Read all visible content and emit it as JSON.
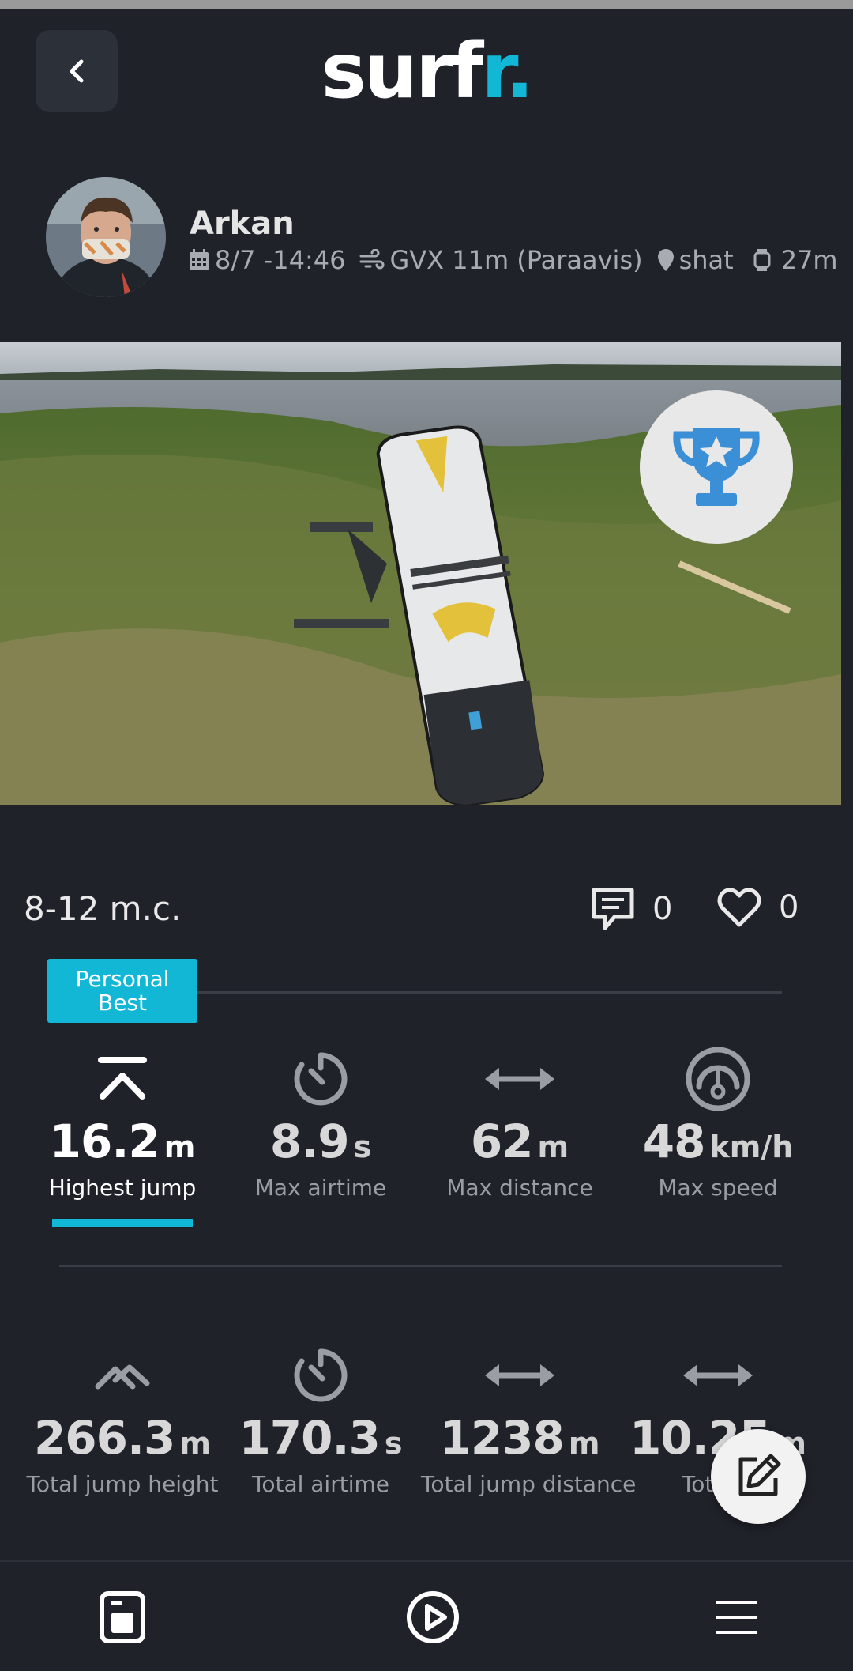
{
  "header": {
    "logo_main": "surf",
    "logo_accent": "r.",
    "back_icon": "chevron-left-icon"
  },
  "session": {
    "user_name": "Arkan",
    "date": "8/7 -14:46",
    "gear": "GVX 11m (Paraavis)",
    "location": "shat",
    "duration": "27m",
    "wind": "8-12 m.c.",
    "comments": "0",
    "likes": "0",
    "badge": "trophy-icon"
  },
  "personal_best": {
    "line1": "Personal",
    "line2": "Best"
  },
  "stats_top": [
    {
      "value": "16.2",
      "unit": "m",
      "label": "Highest jump",
      "icon": "jump-up-icon"
    },
    {
      "value": "8.9",
      "unit": "s",
      "label": "Max airtime",
      "icon": "timer-icon"
    },
    {
      "value": "62",
      "unit": "m",
      "label": "Max distance",
      "icon": "horizontal-arrows-icon"
    },
    {
      "value": "48",
      "unit": "km/h",
      "label": "Max speed",
      "icon": "speedometer-icon"
    }
  ],
  "stats_bottom": [
    {
      "value": "266.3",
      "unit": "m",
      "label": "Total jump height",
      "icon": "double-chevron-up-icon"
    },
    {
      "value": "170.3",
      "unit": "s",
      "label": "Total airtime",
      "icon": "timer-icon"
    },
    {
      "value": "1238",
      "unit": "m",
      "label": "Total jump distance",
      "icon": "horizontal-arrows-icon"
    },
    {
      "value": "10.25",
      "unit": "m",
      "label": "Total d",
      "icon": "horizontal-arrows-icon"
    }
  ],
  "colors": {
    "background": "#1f2229",
    "accent": "#12b7d6",
    "trophy": "#3b8fd6"
  },
  "nav": {
    "items": [
      "sessions-icon",
      "play-icon",
      "menu-icon"
    ]
  }
}
